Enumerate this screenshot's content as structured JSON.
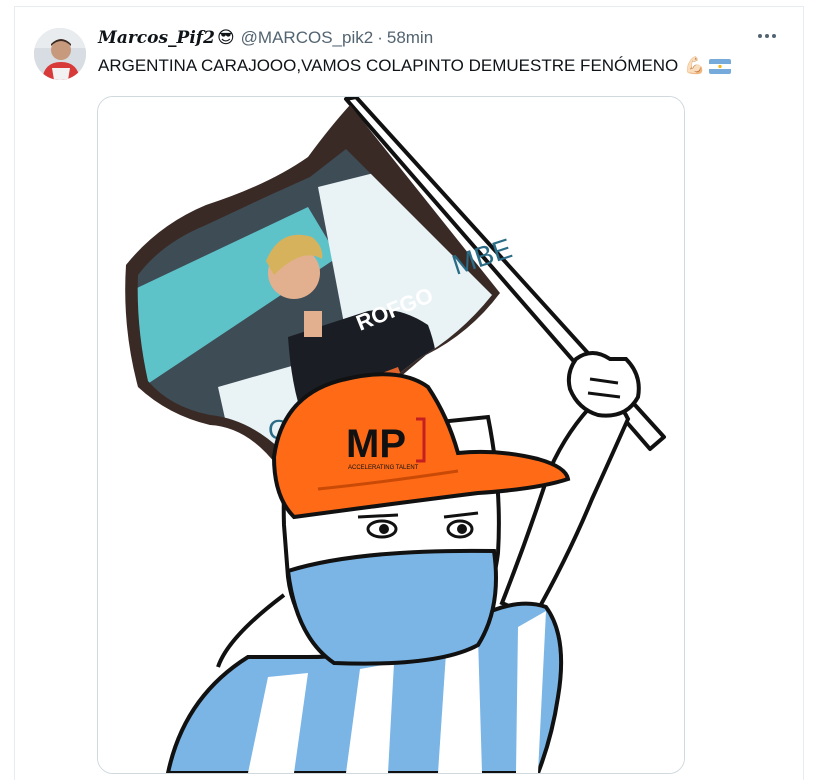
{
  "tweet": {
    "display_name": "Marcos_Pif2",
    "name_emoji": "😎",
    "handle": "@MARCOS_pik2",
    "separator": "·",
    "time": "58min",
    "more_icon": "more-icon",
    "text": "ARGENTINA CARAJOOO,VAMOS COLAPINTO DEMUESTRE FENÓMENO",
    "text_emoji": "💪🏻",
    "flag_icon": "argentina-flag-icon"
  },
  "media": {
    "cap_logo": "MP",
    "cap_tagline": "ACCELERATING TALENT",
    "banner_text": "MBE",
    "suit_text": "ROFGO",
    "corner_text": "O"
  },
  "colors": {
    "cap_orange": "#ff6a17",
    "flag_blue": "#7ab5e6",
    "text_primary": "#0f1419",
    "text_secondary": "#536471"
  }
}
